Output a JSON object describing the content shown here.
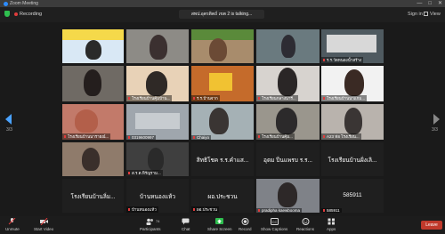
{
  "window": {
    "title": "Zoom Meeting",
    "controls": [
      "—",
      "□",
      "✕"
    ]
  },
  "topbar": {
    "recording_label": "Recording",
    "speaking": "สพป.อุตรดิตถ์ เขต 2 is talking...",
    "signin": "Sign in",
    "view": "View"
  },
  "tiles": [
    {
      "name": "",
      "big": ""
    },
    {
      "name": "",
      "big": ""
    },
    {
      "name": "",
      "big": ""
    },
    {
      "name": "",
      "big": ""
    },
    {
      "name": "ร.ร.วัดหนองน้ำสร้าง",
      "big": ""
    },
    {
      "name": "",
      "big": ""
    },
    {
      "name": "โรงเรียนบ้านคุ้มบ้าน...",
      "big": ""
    },
    {
      "name": "ร.ร.บ้านจาก",
      "big": ""
    },
    {
      "name": "โรงเรียนกลางนารี...",
      "big": ""
    },
    {
      "name": "โรงเรียนบ้านนาแกม...",
      "big": ""
    },
    {
      "name": "โรงเรียนบ้านนารายณ์...",
      "big": ""
    },
    {
      "name": "0319600997",
      "big": ""
    },
    {
      "name": "Chaiyo",
      "big": ""
    },
    {
      "name": "โรงเรียนบ้านคุ้ม...",
      "big": ""
    },
    {
      "name": "A23 ท่อ โรงเรียน...",
      "big": ""
    },
    {
      "name": "",
      "big": ""
    },
    {
      "name": "ส.ร.ต.หิรัญราม...",
      "big": ""
    },
    {
      "name": "",
      "big": "สิทธิโชค ร.ร.คำแส..."
    },
    {
      "name": "",
      "big": "อุดม ปิ่นแพรบ ร.ร..."
    },
    {
      "name": "",
      "big": "โรงเรียนบ้านฝั่งเลิ..."
    },
    {
      "name": "",
      "big": "โรงเรียนบ้านลิ่ม..."
    },
    {
      "name": "บ้านหนองแห้ว",
      "big": "บ้านหนองแห้ว"
    },
    {
      "name": "ผอ.ประชวน",
      "big": "ผอ.ประชวน"
    },
    {
      "name": "pradipha kaewbooma",
      "big": ""
    },
    {
      "name": "585911",
      "big": "585911"
    }
  ],
  "nav": {
    "left_page": "3/3",
    "right_page": "3/3"
  },
  "toolbar": {
    "unmute": "Unmute",
    "start_video": "Start Video",
    "participants": "Participants",
    "participant_count": "74",
    "chat": "Chat",
    "share_screen": "Share Screen",
    "record": "Record",
    "show_captions": "Show Captions",
    "reactions": "Reactions",
    "apps": "Apps",
    "leave": "Leave"
  },
  "colors": {
    "accent": "#2d8cff",
    "share_green": "#2fbf4f",
    "leave_red": "#c0392b",
    "muted_red": "#e03c3c"
  }
}
